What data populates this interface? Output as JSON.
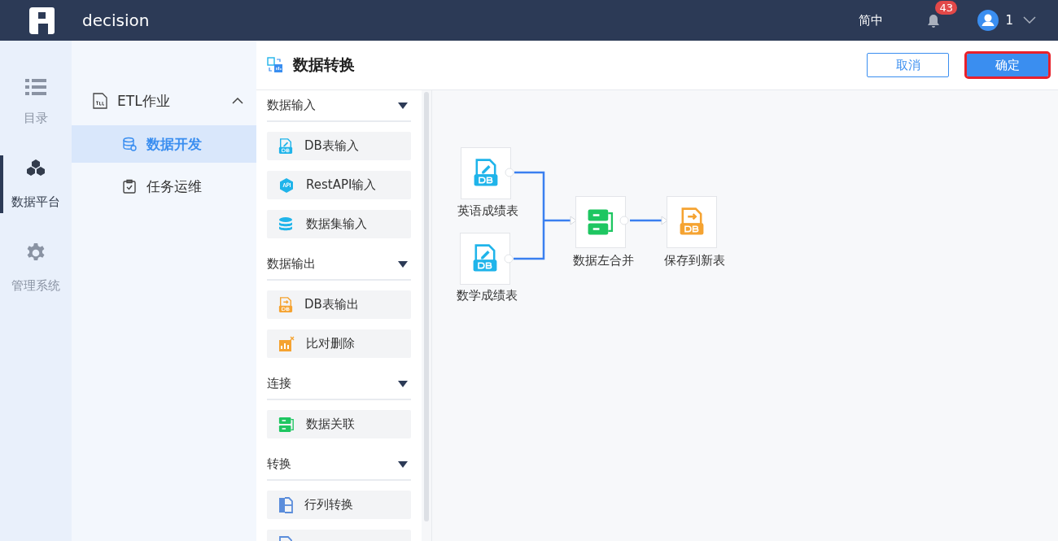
{
  "header": {
    "app_name": "decision",
    "language": "简中",
    "notification_count": "43",
    "user": "1"
  },
  "rail": [
    {
      "label": "目录",
      "kind": "list",
      "selected": false
    },
    {
      "label": "数据平台",
      "kind": "cube",
      "selected": true
    },
    {
      "label": "管理系统",
      "kind": "gear",
      "selected": false
    }
  ],
  "nav": {
    "label": "ETL作业",
    "expanded": true,
    "children": [
      {
        "label": "数据开发",
        "kind": "database",
        "selected": true
      },
      {
        "label": "任务运维",
        "kind": "clipboard",
        "selected": false
      }
    ]
  },
  "page_title": "数据转换",
  "buttons": [
    {
      "label": "取消",
      "kind": "secondary",
      "highlighted": false
    },
    {
      "label": "确定",
      "kind": "primary",
      "highlighted": true
    }
  ],
  "palette": [
    {
      "title": "数据输入",
      "expanded": true,
      "items": [
        {
          "label": "DB表输入",
          "kind": "db-in"
        },
        {
          "label": "RestAPI输入",
          "kind": "api"
        },
        {
          "label": "数据集输入",
          "kind": "dataset"
        }
      ]
    },
    {
      "title": "数据输出",
      "expanded": true,
      "items": [
        {
          "label": "DB表输出",
          "kind": "db-out"
        },
        {
          "label": "比对删除",
          "kind": "compare"
        }
      ]
    },
    {
      "title": "连接",
      "expanded": true,
      "items": [
        {
          "label": "数据关联",
          "kind": "join"
        }
      ]
    },
    {
      "title": "转换",
      "expanded": true,
      "items": [
        {
          "label": "行列转换",
          "kind": "pivot"
        },
        {
          "kind": "json"
        }
      ]
    }
  ],
  "canvas": {
    "nodes": [
      {
        "label": "英语成绩表",
        "kind": "db-in"
      },
      {
        "label": "数学成绩表",
        "kind": "db-in"
      },
      {
        "label": "数据左合并",
        "kind": "join"
      },
      {
        "label": "保存到新表",
        "kind": "db-out"
      }
    ]
  }
}
